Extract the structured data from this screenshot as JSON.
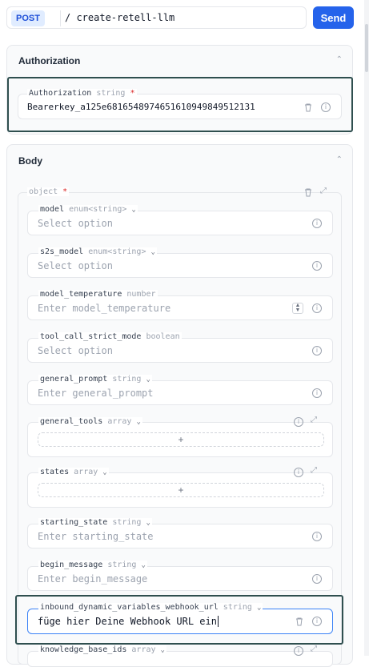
{
  "request": {
    "method": "POST",
    "path": "create-retell-llm",
    "send_label": "Send"
  },
  "authorization": {
    "section_title": "Authorization",
    "field_name": "Authorization",
    "field_type": "string",
    "required_mark": "*",
    "value": "Bearer key_a125e68165489746516109498495 12131"
  },
  "body": {
    "section_title": "Body",
    "object_label": "object",
    "required_mark": "*",
    "fields": [
      {
        "name": "model",
        "type": "enum<string>",
        "placeholder": "Select option"
      },
      {
        "name": "s2s_model",
        "type": "enum<string>",
        "placeholder": "Select option"
      },
      {
        "name": "model_temperature",
        "type": "number",
        "placeholder": "Enter model_temperature"
      },
      {
        "name": "tool_call_strict_mode",
        "type": "boolean",
        "placeholder": "Select option"
      },
      {
        "name": "general_prompt",
        "type": "string",
        "placeholder": "Enter general_prompt"
      },
      {
        "name": "general_tools",
        "type": "array",
        "add_label": "+"
      },
      {
        "name": "states",
        "type": "array",
        "add_label": "+"
      },
      {
        "name": "starting_state",
        "type": "string",
        "placeholder": "Enter starting_state"
      },
      {
        "name": "begin_message",
        "type": "string",
        "placeholder": "Enter begin_message"
      },
      {
        "name": "inbound_dynamic_variables_webhook_url",
        "type": "string",
        "value": "füge hier Deine Webhook URL ein"
      },
      {
        "name": "knowledge_base_ids",
        "type": "array"
      }
    ]
  },
  "icons": {
    "info": "info-icon",
    "trash": "trash-icon",
    "collapse": "collapse-icon",
    "chevron": "chevron-down-icon"
  }
}
